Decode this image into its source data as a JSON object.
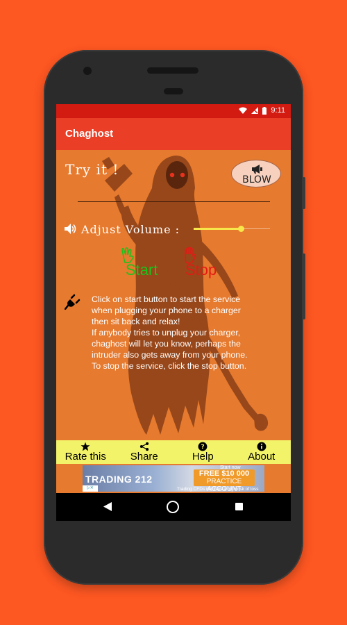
{
  "status_bar": {
    "time": "9:11"
  },
  "app_bar": {
    "title": "Chaghost"
  },
  "main": {
    "try_title": "Try it !",
    "blow_label": "BLOW",
    "volume_label": "Adjust Volume :",
    "volume_level": 0.62,
    "start_label": "Start",
    "stop_label": "Stop",
    "description": "Click on start button to start the service\nwhen plugging your phone to a charger\nthen sit back and relax!\nIf anybody tries to unplug your charger,\nchaghost will let you know, perhaps the\nintruder also gets away from your phone.\nTo stop the service, click the stop button."
  },
  "bottom_nav": [
    {
      "label": "Rate this",
      "icon": "star-icon"
    },
    {
      "label": "Share",
      "icon": "share-icon"
    },
    {
      "label": "Help",
      "icon": "help-icon"
    },
    {
      "label": "About",
      "icon": "info-icon"
    }
  ],
  "ad": {
    "brand": "TRADING 212",
    "top_text": "Start now",
    "cta_line1": "FREE $10 000",
    "cta_line2": "PRACTICE ACCOUNT",
    "disclaimer": "Trading CFDs involves a high risk of loss",
    "choices": "▷✕"
  },
  "colors": {
    "background": "#fd5722",
    "status_bar": "#d31b12",
    "app_bar": "#ea3e27",
    "content": "#e67a2e",
    "bottom_nav": "#f3f36a",
    "start": "#1cc21c",
    "stop": "#e41a14"
  }
}
